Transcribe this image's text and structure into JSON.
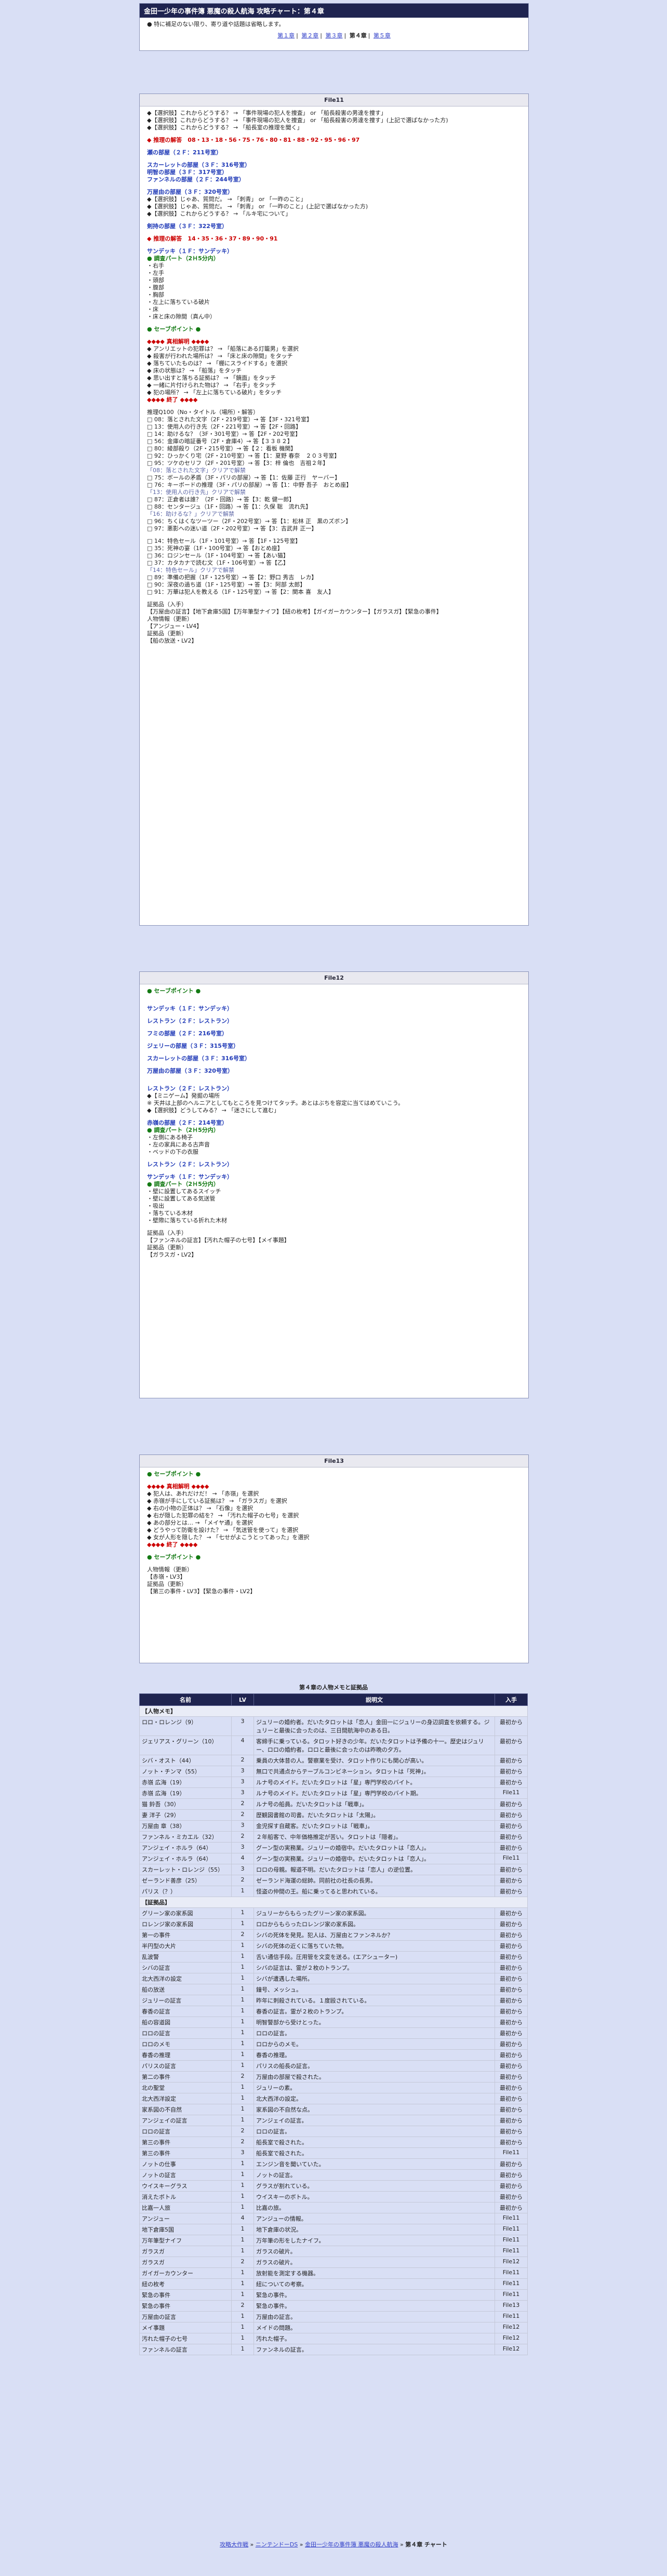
{
  "title": "金田一少年の事件簿 悪魔の殺人航海 攻略チャート：第４章",
  "note": "● 特に補足のない限り、寄り道や話題は省略します。",
  "chapter_nav": [
    "第１章",
    "第２章",
    "第３章",
    "第４章",
    "第５章"
  ],
  "file11": {
    "header": "File11",
    "lines": [
      "◆【選択肢】これからどうする？ → 「事件現場の犯人を捜査」 or 「船長殺害の男達を捜す」",
      "◆【選択肢】これからどうする？ → 「事件現場の犯人を捜査」 or 「船長殺害の男達を捜す」(上記で選ばなかった方)",
      "◆【選択肢】これからどうする？ → 「船長室の推理を聞く」",
      "",
      "◆ 推理の解答　08・13・18・56・75・76・80・81・88・92・95・96・97",
      "",
      "瀬の部屋（２Ｆ：211号室）",
      "",
      "スカーレットの部屋（３Ｆ：316号室）",
      "明智の部屋（３Ｆ：317号室）",
      "ファンネルの部屋（２Ｆ：244号室）",
      "",
      "万屋由の部屋（３Ｆ：320号室）",
      "◆【選択肢】じゃあ、質問だ。 → 「刺青」 or 「一昨のこと」",
      "◆【選択肢】じゃあ、質問だ。 → 「刺青」 or 「一昨のこと」(上記で選ばなかった方)",
      "◆【選択肢】これからどうする？ → 「ルキ宅について」",
      "",
      "剣持の部屋（３Ｆ：322号室）",
      "",
      "◆ 推理の解答　14・35・36・37・89・90・91",
      "",
      "サンデッキ（１Ｆ：サンデッキ）",
      "● 調査パート（2Ｈ5分内）",
      "・右手",
      "・左手",
      "・頭部",
      "・腹部",
      "・胸部",
      "・左上に落ちている破片",
      "・床",
      "・床と床の隙間（真ん中）",
      "",
      "● セーブポイント ●",
      "",
      "◆◆◆◆ 真相解明 ◆◆◆◆",
      "◆ アンリエットの犯罪は？ → 「船落にある灯籠男」を選択",
      "◆ 殺害が行われた場所は？ → 「床と床の隙間」をタッチ",
      "◆ 落ちていたものは？ → 「棚にスライドする」を選択",
      "◆ 床の状態は？ → 「船落」をタッチ",
      "◆ 思い出すと落ちる証拠は？ → 「鏡面」をタッチ",
      "◆ 一緒に片付けられた物は？ → 「右手」をタッチ",
      "◆ 犯の場所？ → 「左上に落ちている破片」をタッチ",
      "◆◆◆◆ 終了 ◆◆◆◆",
      "",
      "推理Q100（No・タイトル（場所）・解答）",
      "□ 08：落とされた文字（2F・219号室）→ 答【3F・321号室】",
      "□ 13：使用人の行き先（2F・221号室）→ 答【2F・回路】",
      "□ 14：助けるな？（3F・301号室）→ 答【2F・202号室】",
      "□ 56：金庫の暗証番号（2F・倉庫4）→ 答【３３８２】",
      "□ 80：綾部殺り（2F・215号室）→ 答【２：看板 機関】",
      "□ 92：ひっかくり宅（2F・210号室）→ 答【1：夏野 春奈　２０３号室】",
      "□ 95：ツケのセリフ（2F・201号室）→ 答【3：梓 倫也　吉祖２年】",
      "「08：落とされた文字」クリアで解禁",
      "□ 75：ボールの矛盾（3F・パリの部屋）→ 答【1：佐藤 正行　ヤーバー】",
      "□ 76：キーボードの推理（3F・パリの部屋）→ 答【1：中野 吾子　おとめ座】",
      "「13：使用人の行き先」クリアで解禁",
      "□ 87：正倉者は誰？（2F・回路）→ 答【3：乾 健一郎】",
      "□ 88：センタージュ（1F・回路）→ 答【1：久保 聡　流れ先】",
      "「16：助けるな？」クリアで解禁",
      "□ 96：ちくはくなツーツー（2F・202号室）→ 答【1：松林 正　黒のズボン】",
      "□ 97：悪影への迷い道（2F・202号室）→ 答【3：吉武井 正一】",
      "",
      "□ 14：特色セール（1F・101号室）→ 答【1F・125号室】",
      "□ 35：死神の宴（1F・100号室）→ 答【おとめ座】",
      "□ 36：ロジンセール（1F・104号室）→ 答【あい猫】",
      "□ 37：カタカナで読む文（1F・106号室）→ 答【乙】",
      "「14：特色セール」クリアで解禁",
      "□ 89：準備の把握（1F・125号室）→ 答【2：野口 秀吉　レカ】",
      "□ 90：深夜の過ち道（1F・125号室）→ 答【3：阿部 太郎】",
      "□ 91：万華は犯人を教える（1F・125号室）→ 答【2：関本 喜　友人】",
      "",
      "証拠品（入手）",
      "【万屋由の証言】【地下倉庫5国】【万年筆型ナイフ】【紐の枚考】【ガイガーカウンター】【ガラスガ】【緊急の事件】",
      "人物情報（更新）",
      "【アンジュー・LV4】",
      "証拠品（更新）",
      "【船の放送・LV2】"
    ]
  },
  "file12": {
    "header": "File12",
    "lines": [
      "● セーブポイント ●",
      "",
      "",
      "サンデッキ（１Ｆ：サンデッキ）",
      "",
      "レストラン（２Ｆ：レストラン）",
      "",
      "フミの部屋（２Ｆ：216号室）",
      "",
      "ジェリーの部屋（３Ｆ：315号室）",
      "",
      "スカーレットの部屋（３Ｆ：316号室）",
      "",
      "万屋由の部屋（３Ｆ：320号室）",
      "",
      "",
      "レストラン（２Ｆ：レストラン）",
      "◆【ミニゲーム】発掘の場所",
      "※ 天井は上部のヘルニアとしてもところを見つけてタッチ。あとはぶちを容定に当てはめていこう。",
      "◆【選択肢】どうしてみる？ → 「迷さにして進む」",
      "",
      "赤嶺の部屋（２Ｆ：214号室）",
      "● 調査パート（2Ｈ5分内）",
      "・左側にある椅子",
      "・左の家具にある古声音",
      "・ベッドの下の衣服",
      "",
      "レストラン（２Ｆ：レストラン）",
      "",
      "サンデッキ（１Ｆ：サンデッキ）",
      "● 調査パート（2Ｈ5分内）",
      "・壁に設置してあるスイッチ",
      "・壁に設置してある気送管",
      "・吸出",
      "・落ちている木材",
      "・壁際に落ちている折れた木材",
      "",
      "証拠品（入手）",
      "【ファンネルの証言】【汚れた帽子の七号】【メイ事題】",
      "証拠品（更新）",
      "【ガラスガ・LV2】"
    ]
  },
  "file13": {
    "header": "File13",
    "lines": [
      "● セーブポイント ●",
      "",
      "◆◆◆◆ 真相解明 ◆◆◆◆",
      "◆ 犯人は、あれだけだ！ → 「赤嶺」を選択",
      "◆ 赤嶺が手にしている証拠は？ → 「ガラスガ」を選択",
      "◆ 右の小物の正体は？ → 「石像」を選択",
      "◆ 右が隠した犯罪の結を？ → 「汚れた帽子の七号」を選択",
      "◆ あの部分とは… → 「メイヤ通」を選択",
      "◆ どうやって防衛を設けた？ → 「気送管を使って」を選択",
      "◆ 女が人形を隠した？ → 「七せがよこうとってあった」を選択",
      "◆◆◆◆ 終了 ◆◆◆◆",
      "",
      "● セーブポイント ●",
      "",
      "人物情報（更新）",
      "【赤嶺・LV3】",
      "証拠品（更新）",
      "【第三の事件・LV3】【緊急の事件・LV2】"
    ]
  },
  "table_title": "第４章の人物メモと証拠品",
  "table_headers": [
    "名前",
    "LV",
    "説明文",
    "入手"
  ],
  "persons_label": "【人物メモ】",
  "persons": [
    [
      "ロロ・ロレンジ（9）",
      "3",
      "ジュリーの婚約者。だいたタロットは「恋人」金田一にジュリーの身辺調査を依頼する。ジュリーと最後に会ったのは、三日間航海中のある日。",
      "最初から"
    ],
    [
      "ジェリアス・グリーン（10）",
      "4",
      "客締手に乗っている。タロット好きの少年。だいたタロットは予備の十一。歴史はジュリー、ロロの婚約者。ロロと最後に会ったのは昨晩の夕方。",
      "最初から"
    ],
    [
      "シバ・オスト（44）",
      "2",
      "乗員の大体昔の人。警察業を受け、タロット作りにも関心が高い。",
      "最初から"
    ],
    [
      "ノット・チンマ（55）",
      "3",
      "無口で共通点からテーブルコンビネーション。タロットは「死神」。",
      "最初から"
    ],
    [
      "赤嶺 広海（19）",
      "3",
      "ルナ号のメイド。だいたタロットは「星」専門学校のバイト。",
      "最初から"
    ],
    [
      "赤嶺 広海（19）",
      "3",
      "ルナ号のメイド。だいたタロットは「星」専門学校のバイト期。",
      "File11"
    ],
    [
      "猫 鈴吾（30）",
      "2",
      "ルナ号の船員。だいたタロットは「戦車」。",
      "最初から"
    ],
    [
      "妻 洋子（29）",
      "2",
      "歴観図書館の司書。だいたタロットは「太陽」。",
      "最初から"
    ],
    [
      "万屋由 章（38）",
      "3",
      "金児探す自蔵客。だいたタロットは「戦車」。",
      "最初から"
    ],
    [
      "ファンネル・ミカエル（32）",
      "2",
      "２年船客で、中年価格推定が苦い。タロットは「隠者」。",
      "最初から"
    ],
    [
      "アンジェイ・ホルラ（64）",
      "3",
      "グーン型の実務業。ジュリーの婚宿中。だいたタロットは「恋人」。",
      "最初から"
    ],
    [
      "アンジェイ・ホルラ（64）",
      "4",
      "グーン型の実務業。ジュリーの婚宿中。だいたタロットは「恋人」。",
      "File11"
    ],
    [
      "スカーレット・ロレンジ（55）",
      "3",
      "ロロの母親。報道不明。だいたタロットは「恋人」の逆位置。",
      "最初から"
    ],
    [
      "ゼーランド善彦（25）",
      "2",
      "ゼーランド海運の総帥。同前社の社長の長男。",
      "最初から"
    ],
    [
      "パリス（？）",
      "1",
      "怪盗の仲間の王。船に乗ってると思われている。",
      "最初から"
    ]
  ],
  "evidence_label": "【証拠品】",
  "evidence": [
    [
      "グリーン家の家系図",
      "1",
      "ジュリーからもらったグリーン家の家系図。",
      "最初から"
    ],
    [
      "ロレンジ家の家系図",
      "1",
      "ロロからもらったロレンジ家の家系図。",
      "最初から"
    ],
    [
      "第一の事件",
      "2",
      "シバの死体を発見。犯人は、万屋由とファンネルか？",
      "最初から"
    ],
    [
      "半円型の大片",
      "1",
      "シバの死体の近くに落ちていた物。",
      "最初から"
    ],
    [
      "乱波警",
      "1",
      "舌い通信手段。圧用管を文変を送る。(エアシューター)",
      "最初から"
    ],
    [
      "シバの証言",
      "1",
      "シバの証言は、霊が２枚のトランプ。",
      "最初から"
    ],
    [
      "北大西洋の設定",
      "1",
      "シバが遭遇した場所。",
      "最初から"
    ],
    [
      "船の放送",
      "1",
      "鐘号、メッシュ。",
      "最初から"
    ],
    [
      "ジュリーの証言",
      "1",
      "昨年に刺殺されている。１度殴されている。",
      "最初から"
    ],
    [
      "春香の証言",
      "1",
      "春香の証言。霊が２枚のトランプ。",
      "最初から"
    ],
    [
      "船の容道図",
      "1",
      "明智警部から受けとった。",
      "最初から"
    ],
    [
      "ロロの証言",
      "1",
      "ロロの証言。",
      "最初から"
    ],
    [
      "ロロのメモ",
      "1",
      "ロロからのメモ。",
      "最初から"
    ],
    [
      "春香の推理",
      "1",
      "春香の推理。",
      "最初から"
    ],
    [
      "パリスの証言",
      "1",
      "パリスの船長の証言。",
      "最初から"
    ],
    [
      "第二の事件",
      "2",
      "万屋由の部屋で殺された。",
      "最初から"
    ],
    [
      "北の聖堂",
      "1",
      "ジュリーの素。",
      "最初から"
    ],
    [
      "北大西洋設定",
      "1",
      "北大西洋の設定。",
      "最初から"
    ],
    [
      "家系図の不自然",
      "1",
      "家系図の不自然な点。",
      "最初から"
    ],
    [
      "アンジェイの証言",
      "1",
      "アンジェイの証言。",
      "最初から"
    ],
    [
      "ロロの証言",
      "2",
      "ロロの証言。",
      "最初から"
    ],
    [
      "第三の事件",
      "2",
      "船長室で殺された。",
      "最初から"
    ],
    [
      "第三の事件",
      "3",
      "船長室で殺された。",
      "File11"
    ],
    [
      "ノットの仕事",
      "1",
      "エンジン音を聞いていた。",
      "最初から"
    ],
    [
      "ノットの証言",
      "1",
      "ノットの証言。",
      "最初から"
    ],
    [
      "ウイスキーグラス",
      "1",
      "グラスが割れている。",
      "最初から"
    ],
    [
      "消えたボトル",
      "1",
      "ウイスキーのボトル。",
      "最初から"
    ],
    [
      "比嘉一人旅",
      "1",
      "比嘉の旅。",
      "最初から"
    ],
    [
      "アンジュー",
      "4",
      "アンジューの情報。",
      "File11"
    ],
    [
      "地下倉庫5国",
      "1",
      "地下倉庫の状況。",
      "File11"
    ],
    [
      "万年筆型ナイフ",
      "1",
      "万年筆の形をしたナイフ。",
      "File11"
    ],
    [
      "ガラスガ",
      "1",
      "ガラスの破片。",
      "File11"
    ],
    [
      "ガラスガ",
      "2",
      "ガラスの破片。",
      "File12"
    ],
    [
      "ガイガーカウンター",
      "1",
      "放射能を測定する機器。",
      "File11"
    ],
    [
      "紐の枚考",
      "1",
      "紐についての考察。",
      "File11"
    ],
    [
      "緊急の事件",
      "1",
      "緊急の事件。",
      "File11"
    ],
    [
      "緊急の事件",
      "2",
      "緊急の事件。",
      "File13"
    ],
    [
      "万屋由の証言",
      "1",
      "万屋由の証言。",
      "File11"
    ],
    [
      "メイ事題",
      "1",
      "メイドの問題。",
      "File12"
    ],
    [
      "汚れた帽子の七号",
      "1",
      "汚れた帽子。",
      "File12"
    ],
    [
      "ファンネルの証言",
      "1",
      "ファンネルの証言。",
      "File12"
    ]
  ],
  "footer_nav": [
    "攻略大作戦",
    "ニンテンドーDS",
    "金田一少年の事件簿 悪魔の殺人航海",
    "第４章 チャート"
  ]
}
